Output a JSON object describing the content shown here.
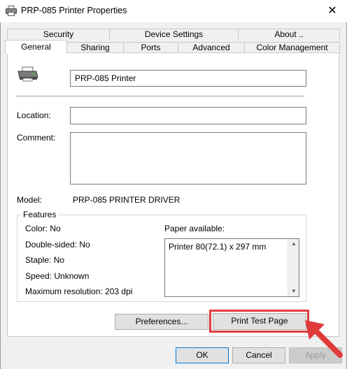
{
  "window": {
    "title": "PRP-085 Printer Properties",
    "close_glyph": "✕"
  },
  "tabs_row1": [
    {
      "label": "Security"
    },
    {
      "label": "Device Settings"
    },
    {
      "label": "About .."
    }
  ],
  "tabs_row2": [
    {
      "label": "General",
      "active": true
    },
    {
      "label": "Sharing"
    },
    {
      "label": "Ports"
    },
    {
      "label": "Advanced"
    },
    {
      "label": "Color Management"
    }
  ],
  "general": {
    "printer_name": "PRP-085 Printer",
    "location_label": "Location:",
    "location_value": "",
    "comment_label": "Comment:",
    "comment_value": "",
    "model_label": "Model:",
    "model_value": "PRP-085 PRINTER DRIVER"
  },
  "features": {
    "title": "Features",
    "color": "Color: No",
    "double_sided": "Double-sided: No",
    "staple": "Staple: No",
    "speed": "Speed: Unknown",
    "max_resolution": "Maximum resolution: 203 dpi",
    "paper_label": "Paper available:",
    "paper_items": [
      "Printer 80(72.1) x 297 mm"
    ]
  },
  "buttons": {
    "preferences": "Preferences...",
    "print_test_page": "Print Test Page",
    "ok": "OK",
    "cancel": "Cancel",
    "apply": "Apply"
  },
  "colors": {
    "highlight": "#e03b3b",
    "accent": "#0078d7"
  }
}
